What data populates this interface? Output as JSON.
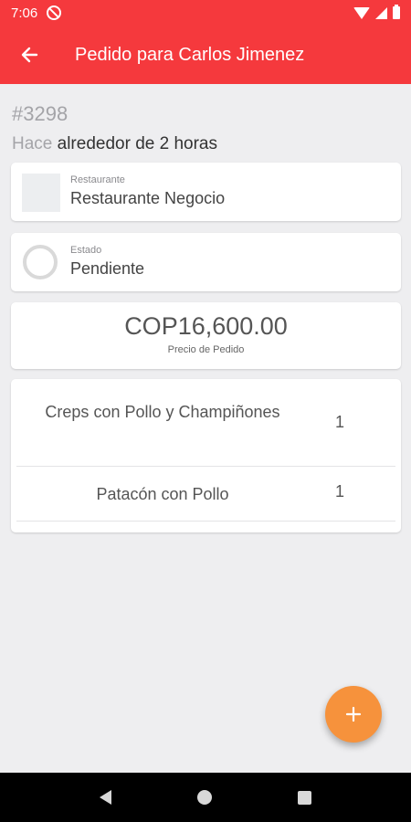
{
  "status_bar": {
    "time": "7:06"
  },
  "app_bar": {
    "title": "Pedido para Carlos Jimenez"
  },
  "order": {
    "number": "#3298",
    "time_prefix": "Hace",
    "time_text": "alrededor de 2 horas"
  },
  "restaurant": {
    "label": "Restaurante",
    "value": "Restaurante Negocio"
  },
  "state": {
    "label": "Estado",
    "value": "Pendiente"
  },
  "price": {
    "amount": "COP16,600.00",
    "label": "Precio de Pedido"
  },
  "items": [
    {
      "name": "Creps con Pollo y Champiñones",
      "qty": "1"
    },
    {
      "name": "Patacón con Pollo",
      "qty": "1"
    }
  ],
  "fab": {
    "label": "+"
  },
  "colors": {
    "primary": "#f5393d",
    "accent": "#f6923c",
    "background": "#eeeef0"
  }
}
